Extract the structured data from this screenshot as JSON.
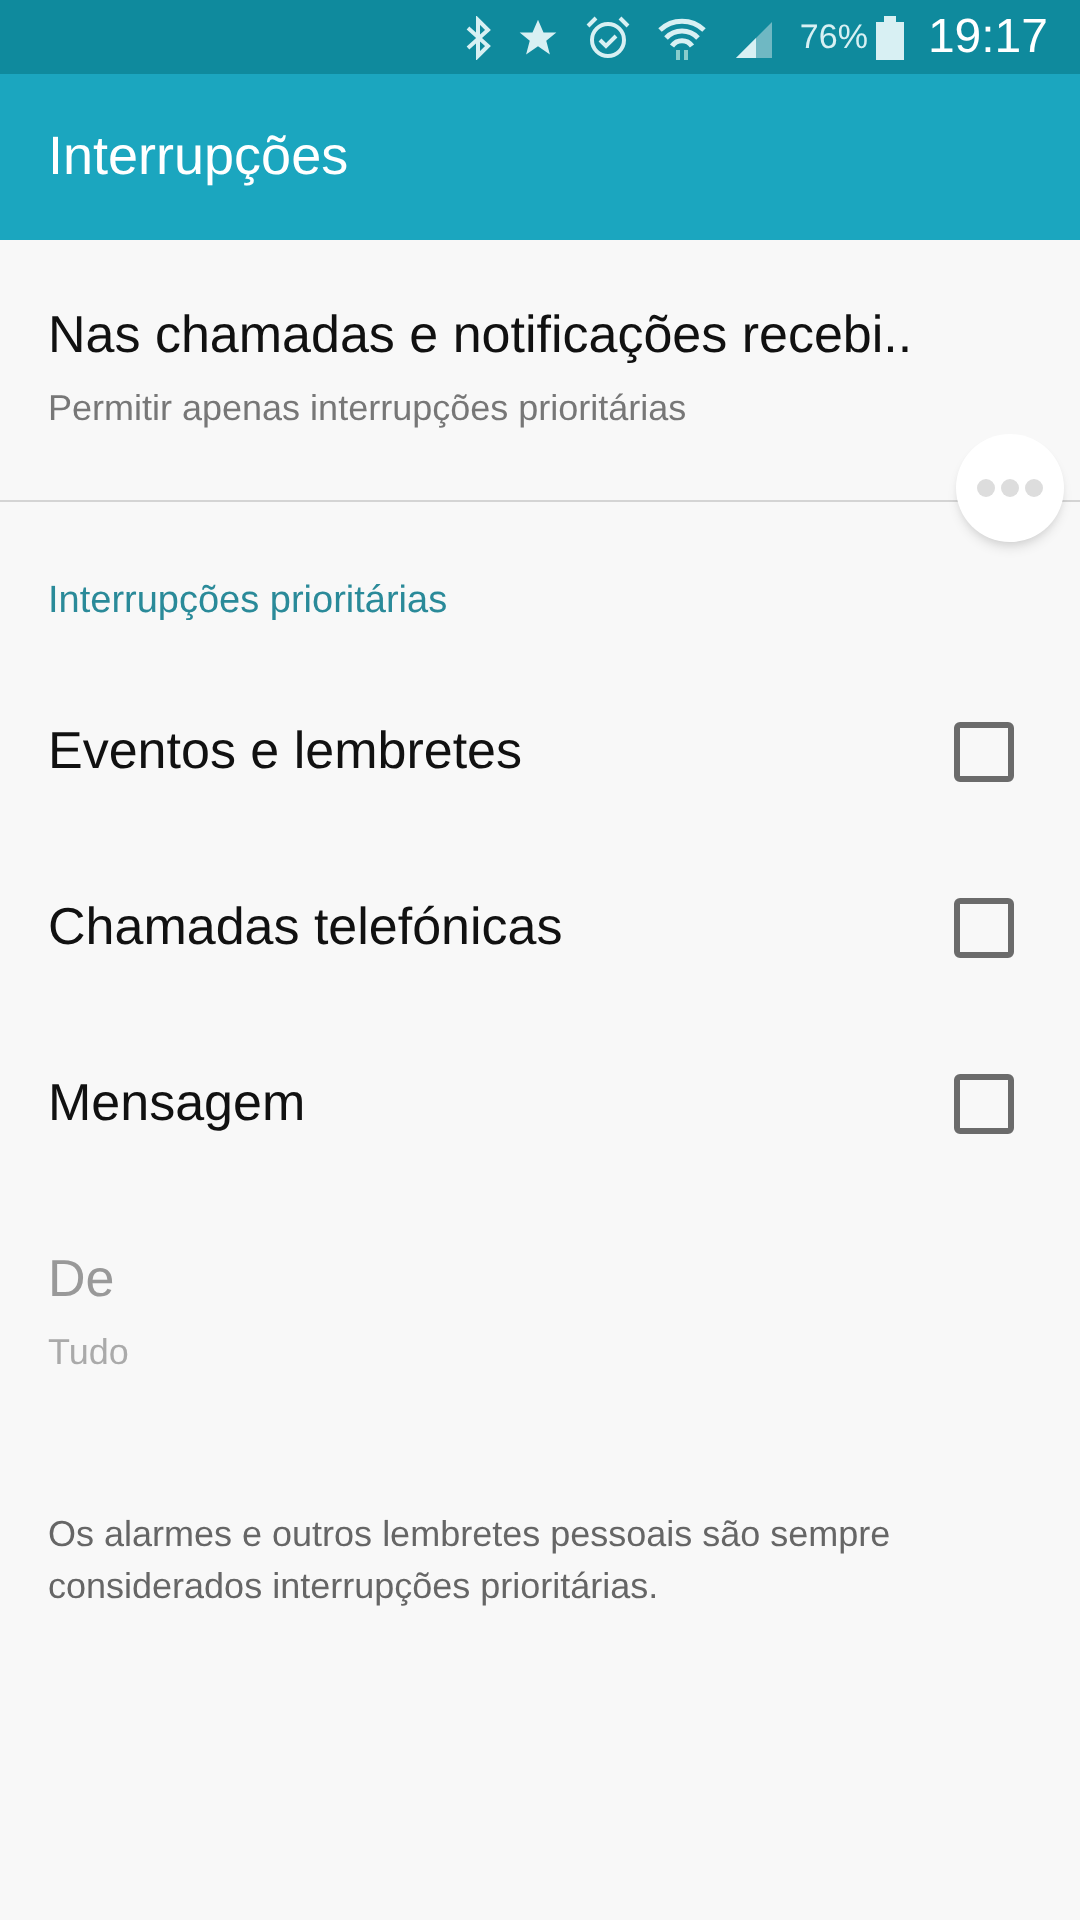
{
  "status_bar": {
    "battery": "76%",
    "time": "19:17"
  },
  "app_bar": {
    "title": "Interrupções"
  },
  "mode": {
    "title": "Nas chamadas e notificações recebi..",
    "summary": "Permitir apenas interrupções prioritárias"
  },
  "section": {
    "title": "Interrupções prioritárias"
  },
  "items": [
    {
      "kind": "checkbox",
      "label": "Eventos e lembretes",
      "checked": false
    },
    {
      "kind": "checkbox",
      "label": "Chamadas telefónicas",
      "checked": false
    },
    {
      "kind": "checkbox",
      "label": "Mensagem",
      "checked": false
    },
    {
      "kind": "value",
      "label": "De",
      "summary": "Tudo",
      "disabled": true
    }
  ],
  "note": "Os alarmes e outros lembretes pessoais são sempre considerados interrupções prioritárias."
}
